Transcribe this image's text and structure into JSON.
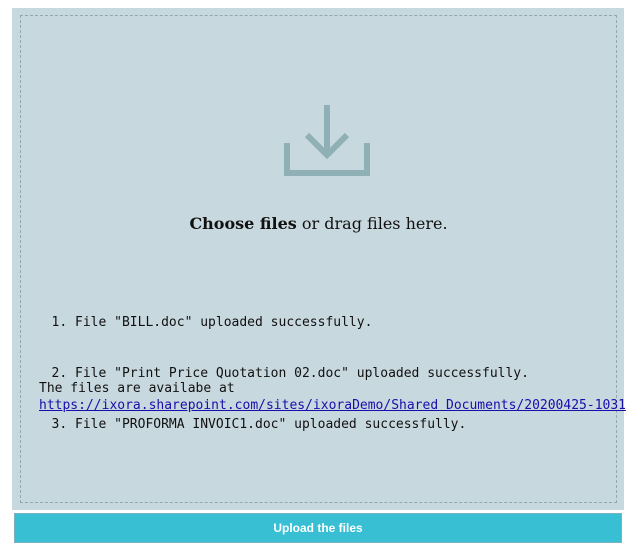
{
  "dropzone": {
    "icon": "download-tray-icon",
    "choose_label": "Choose files",
    "drag_text": " or drag files here."
  },
  "results": {
    "items": [
      "File \"BILL.doc\" uploaded successfully.",
      "File \"Print Price Quotation 02.doc\" uploaded successfully.",
      "File \"PROFORMA INVOIC1.doc\" uploaded successfully."
    ],
    "location_label": "The files are availabe at",
    "location_url": "https://ixora.sharepoint.com/sites/ixoraDemo/Shared Documents/20200425-1031"
  },
  "actions": {
    "upload_label": "Upload the files"
  },
  "colors": {
    "panel": "#c8d8df",
    "icon": "#8fb0b5",
    "button": "#38bfd4",
    "link": "#1a0dab"
  }
}
